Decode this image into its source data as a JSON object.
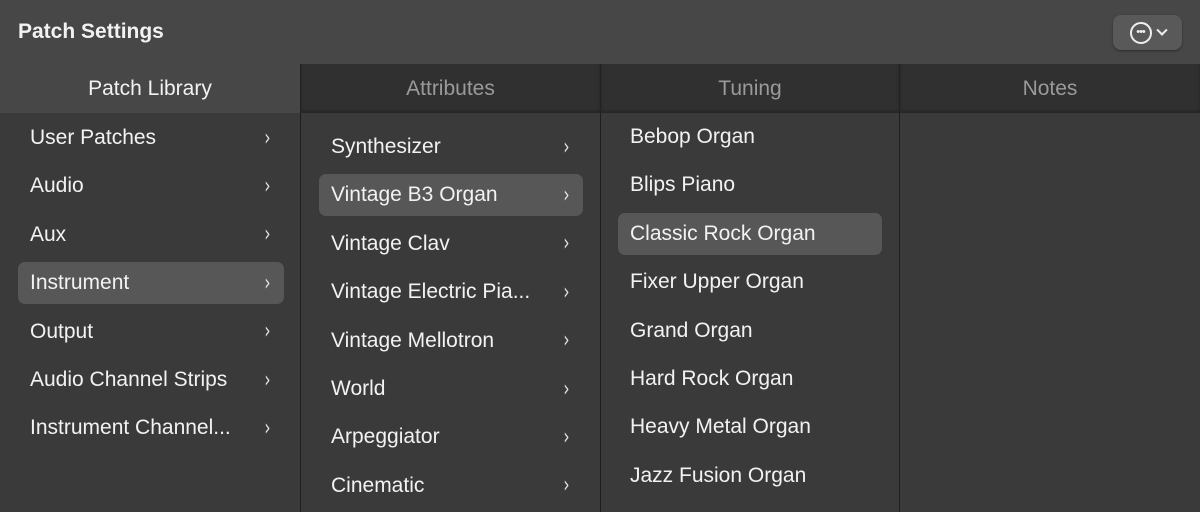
{
  "header": {
    "title": "Patch Settings",
    "more_icon": "ellipsis-circle-icon"
  },
  "tabs": [
    "Patch Library",
    "Attributes",
    "Tuning",
    "Notes"
  ],
  "patch_library": [
    "User Patches",
    "Audio",
    "Aux",
    "Instrument",
    "Output",
    "Audio Channel Strips",
    "Instrument Channel..."
  ],
  "attributes": [
    "Synthesizer",
    "Vintage B3 Organ",
    "Vintage Clav",
    "Vintage Electric Pia...",
    "Vintage Mellotron",
    "World",
    "Arpeggiator",
    "Cinematic"
  ],
  "tuning": [
    "Bebop Organ",
    "Blips Piano",
    "Classic Rock Organ",
    "Fixer Upper Organ",
    "Grand Organ",
    "Hard Rock Organ",
    "Heavy Metal Organ",
    "Jazz Fusion Organ"
  ],
  "selected": {
    "patch_library": 3,
    "attributes": 1,
    "tuning": 2
  },
  "arrow": "›"
}
